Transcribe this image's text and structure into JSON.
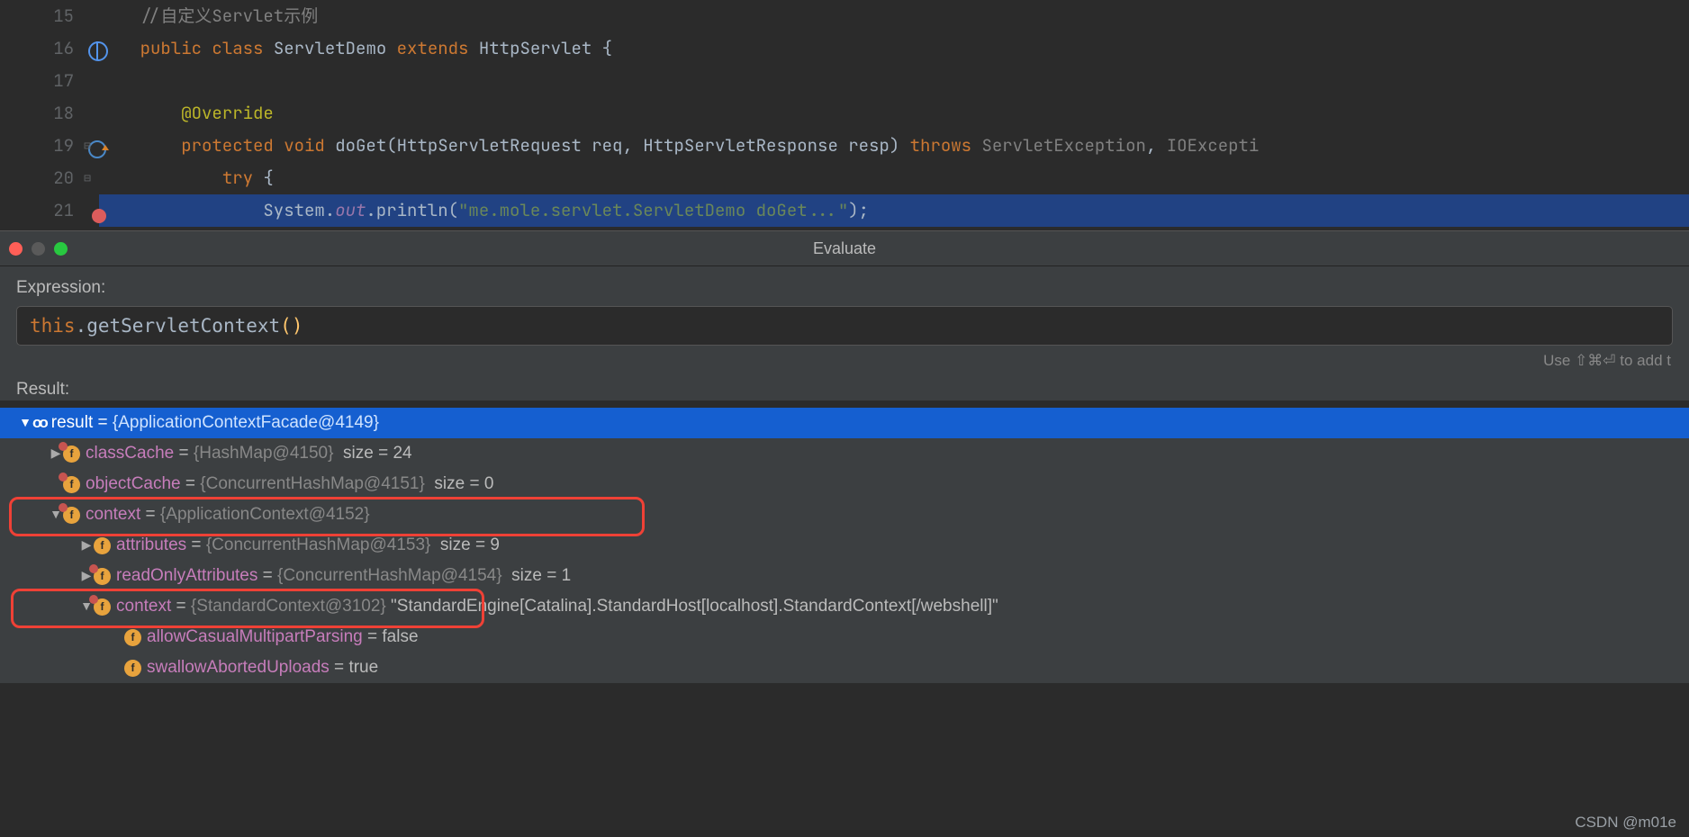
{
  "editor": {
    "lines": [
      {
        "n": "15",
        "icon": "",
        "fold": "",
        "cls": "",
        "html": "    <span class='cmt'>//自定义Servlet示例</span>"
      },
      {
        "n": "16",
        "icon": "globe",
        "fold": "",
        "cls": "",
        "html": "    <span class='kw'>public</span> <span class='kw'>class</span> <span class='typ'>ServletDemo</span> <span class='kw'>extends</span> <span class='typ'>HttpServlet</span> {"
      },
      {
        "n": "17",
        "icon": "",
        "fold": "",
        "cls": "",
        "html": " "
      },
      {
        "n": "18",
        "icon": "",
        "fold": "",
        "cls": "",
        "html": "        <span class='ann'>@Override</span>"
      },
      {
        "n": "19",
        "icon": "override",
        "fold": "⊟",
        "cls": "",
        "html": "        <span class='kw'>protected</span> <span class='kw'>void</span> <span class='typ'>doGet</span>(HttpServletRequest req, HttpServletResponse resp) <span class='kw'>throws</span> <span class='dim'>ServletException</span>, <span class='dim'>IOExcepti</span>"
      },
      {
        "n": "20",
        "icon": "",
        "fold": "⊟",
        "cls": "",
        "html": "            <span class='kw'>try</span> {"
      },
      {
        "n": "21",
        "icon": "bp",
        "fold": "",
        "cls": "hl-line",
        "html": "                System.<span class='static'>out</span>.println(<span class='str'>\"me.mole.servlet.ServletDemo doGet...\"</span>);"
      }
    ]
  },
  "dialog": {
    "title": "Evaluate",
    "expression_label": "Expression:",
    "expression": {
      "this": "this",
      "dot1": ".",
      "call": "getServletContext",
      "paren": "()"
    },
    "hint": "Use ⇧⌘⏎ to add t",
    "result_label": "Result:"
  },
  "tree": [
    {
      "depth": 0,
      "arrow": "v",
      "icon": "oo",
      "name": "result",
      "eq": " = ",
      "val": "{ApplicationContextFacade@4149} ",
      "sel": true
    },
    {
      "depth": 1,
      "arrow": ">",
      "icon": "fp",
      "name": "classCache",
      "eq": " = ",
      "val": "{HashMap@4150} ",
      "extra": " size = 24"
    },
    {
      "depth": 1,
      "arrow": "",
      "icon": "fp",
      "name": "objectCache",
      "eq": " = ",
      "val": "{ConcurrentHashMap@4151} ",
      "extra": " size = 0"
    },
    {
      "depth": 1,
      "arrow": "v",
      "icon": "fp",
      "name": "context",
      "eq": " = ",
      "val": "{ApplicationContext@4152} ",
      "boxed": 1
    },
    {
      "depth": 2,
      "arrow": ">",
      "icon": "f",
      "name": "attributes",
      "eq": " = ",
      "val": "{ConcurrentHashMap@4153} ",
      "extra": " size = 9"
    },
    {
      "depth": 2,
      "arrow": ">",
      "icon": "fp",
      "name": "readOnlyAttributes",
      "eq": " = ",
      "val": "{ConcurrentHashMap@4154} ",
      "extra": " size = 1"
    },
    {
      "depth": 2,
      "arrow": "v",
      "icon": "fp",
      "name": "context",
      "eq": " = ",
      "val": "{StandardContext@3102} ",
      "extra": "\"StandardEngine[Catalina].StandardHost[localhost].StandardContext[/webshell]\"",
      "boxed": 2
    },
    {
      "depth": 3,
      "arrow": "",
      "icon": "f",
      "name": "allowCasualMultipartParsing",
      "eq": " = ",
      "plain": "false"
    },
    {
      "depth": 3,
      "arrow": "",
      "icon": "f",
      "name": "swallowAbortedUploads",
      "eq": " = ",
      "plain": "true"
    }
  ],
  "watermark": "CSDN @m01e"
}
